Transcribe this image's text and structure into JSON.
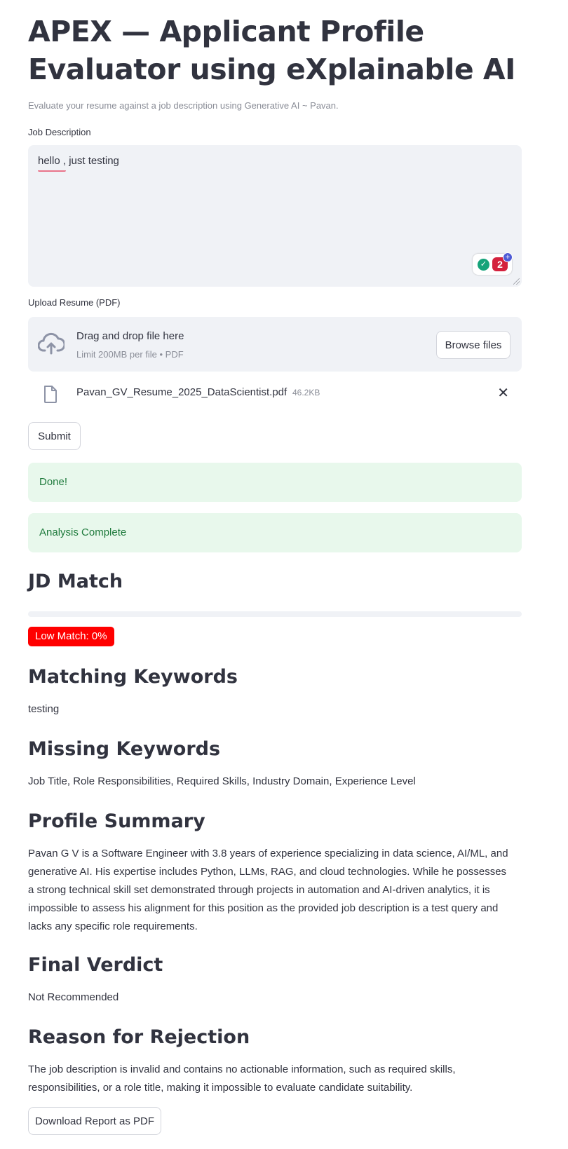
{
  "header": {
    "title": "APEX — Applicant Profile Evaluator using eXplainable AI",
    "caption": "Evaluate your resume against a job description using Generative AI ~ Pavan."
  },
  "job_description": {
    "label": "Job Description",
    "value": "hello , just testing",
    "extension_badge_count": "2",
    "extension_badge_plus": "+"
  },
  "upload": {
    "label": "Upload Resume (PDF)",
    "drop_title": "Drag and drop file here",
    "limit_text": "Limit 200MB per file • PDF",
    "browse_label": "Browse files",
    "file": {
      "name": "Pavan_GV_Resume_2025_DataScientist.pdf",
      "size": "46.2KB"
    },
    "remove_icon": "close-icon"
  },
  "submit_label": "Submit",
  "alerts": {
    "done": "Done!",
    "analysis": "Analysis Complete"
  },
  "jd_match": {
    "heading": "JD Match",
    "progress_fraction": 0.0,
    "badge": "Low Match: 0%",
    "badge_color": "#ff0000"
  },
  "matching": {
    "heading": "Matching Keywords",
    "text": "testing"
  },
  "missing": {
    "heading": "Missing Keywords",
    "text": "Job Title, Role Responsibilities, Required Skills, Industry Domain, Experience Level"
  },
  "summary": {
    "heading": "Profile Summary",
    "text": "Pavan G V is a Software Engineer with 3.8 years of experience specializing in data science, AI/ML, and generative AI. His expertise includes Python, LLMs, RAG, and cloud technologies. While he possesses a strong technical skill set demonstrated through projects in automation and AI-driven analytics, it is impossible to assess his alignment for this position as the provided job description is a test query and lacks any specific role requirements."
  },
  "verdict": {
    "heading": "Final Verdict",
    "text": "Not Recommended"
  },
  "rejection": {
    "heading": "Reason for Rejection",
    "text": "The job description is invalid and contains no actionable information, such as required skills, responsibilities, or a role title, making it impossible to evaluate candidate suitability."
  },
  "download_label": "Download Report as PDF",
  "colors": {
    "success_bg": "#e8f8ec",
    "success_text": "#1e7a3c",
    "panel_bg": "#f0f2f6"
  }
}
